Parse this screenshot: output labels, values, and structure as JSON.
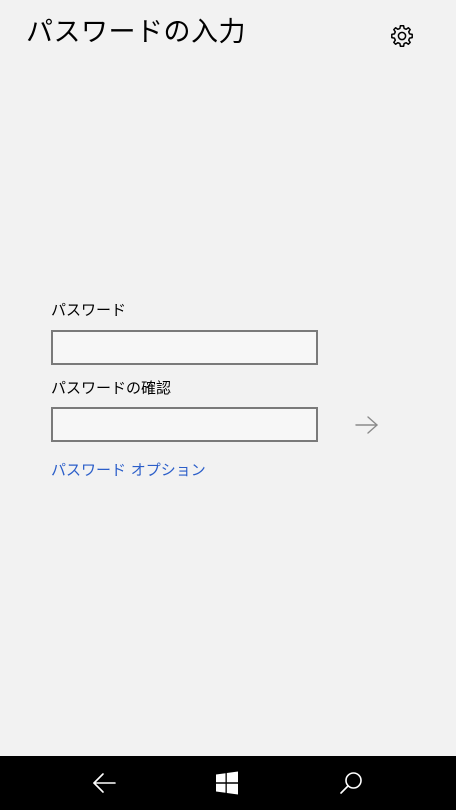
{
  "header": {
    "title": "パスワードの入力",
    "settings_icon": "gear-icon"
  },
  "form": {
    "password_label": "パスワード",
    "password_value": "",
    "confirm_label": "パスワードの確認",
    "confirm_value": "",
    "submit_icon": "arrow-right-icon",
    "options_link": "パスワード オプション"
  },
  "nav_bar": {
    "back_icon": "back-arrow-icon",
    "home_icon": "windows-logo-icon",
    "search_icon": "search-icon"
  },
  "colors": {
    "background": "#f2f2f2",
    "link": "#2b5ec9",
    "field_border": "#7a7a7a",
    "nav_bar": "#000000"
  }
}
